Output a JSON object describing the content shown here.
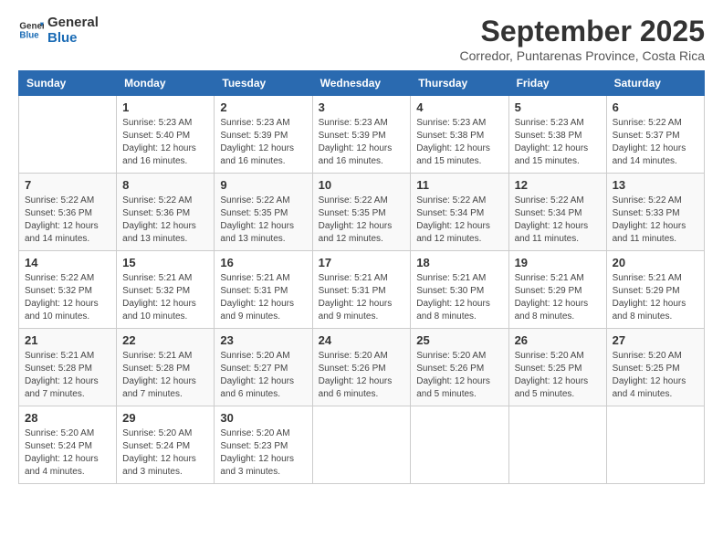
{
  "logo": {
    "text_general": "General",
    "text_blue": "Blue"
  },
  "title": {
    "month_year": "September 2025",
    "location": "Corredor, Puntarenas Province, Costa Rica"
  },
  "weekdays": [
    "Sunday",
    "Monday",
    "Tuesday",
    "Wednesday",
    "Thursday",
    "Friday",
    "Saturday"
  ],
  "weeks": [
    [
      {
        "day": "",
        "info": ""
      },
      {
        "day": "1",
        "info": "Sunrise: 5:23 AM\nSunset: 5:40 PM\nDaylight: 12 hours\nand 16 minutes."
      },
      {
        "day": "2",
        "info": "Sunrise: 5:23 AM\nSunset: 5:39 PM\nDaylight: 12 hours\nand 16 minutes."
      },
      {
        "day": "3",
        "info": "Sunrise: 5:23 AM\nSunset: 5:39 PM\nDaylight: 12 hours\nand 16 minutes."
      },
      {
        "day": "4",
        "info": "Sunrise: 5:23 AM\nSunset: 5:38 PM\nDaylight: 12 hours\nand 15 minutes."
      },
      {
        "day": "5",
        "info": "Sunrise: 5:23 AM\nSunset: 5:38 PM\nDaylight: 12 hours\nand 15 minutes."
      },
      {
        "day": "6",
        "info": "Sunrise: 5:22 AM\nSunset: 5:37 PM\nDaylight: 12 hours\nand 14 minutes."
      }
    ],
    [
      {
        "day": "7",
        "info": "Sunrise: 5:22 AM\nSunset: 5:36 PM\nDaylight: 12 hours\nand 14 minutes."
      },
      {
        "day": "8",
        "info": "Sunrise: 5:22 AM\nSunset: 5:36 PM\nDaylight: 12 hours\nand 13 minutes."
      },
      {
        "day": "9",
        "info": "Sunrise: 5:22 AM\nSunset: 5:35 PM\nDaylight: 12 hours\nand 13 minutes."
      },
      {
        "day": "10",
        "info": "Sunrise: 5:22 AM\nSunset: 5:35 PM\nDaylight: 12 hours\nand 12 minutes."
      },
      {
        "day": "11",
        "info": "Sunrise: 5:22 AM\nSunset: 5:34 PM\nDaylight: 12 hours\nand 12 minutes."
      },
      {
        "day": "12",
        "info": "Sunrise: 5:22 AM\nSunset: 5:34 PM\nDaylight: 12 hours\nand 11 minutes."
      },
      {
        "day": "13",
        "info": "Sunrise: 5:22 AM\nSunset: 5:33 PM\nDaylight: 12 hours\nand 11 minutes."
      }
    ],
    [
      {
        "day": "14",
        "info": "Sunrise: 5:22 AM\nSunset: 5:32 PM\nDaylight: 12 hours\nand 10 minutes."
      },
      {
        "day": "15",
        "info": "Sunrise: 5:21 AM\nSunset: 5:32 PM\nDaylight: 12 hours\nand 10 minutes."
      },
      {
        "day": "16",
        "info": "Sunrise: 5:21 AM\nSunset: 5:31 PM\nDaylight: 12 hours\nand 9 minutes."
      },
      {
        "day": "17",
        "info": "Sunrise: 5:21 AM\nSunset: 5:31 PM\nDaylight: 12 hours\nand 9 minutes."
      },
      {
        "day": "18",
        "info": "Sunrise: 5:21 AM\nSunset: 5:30 PM\nDaylight: 12 hours\nand 8 minutes."
      },
      {
        "day": "19",
        "info": "Sunrise: 5:21 AM\nSunset: 5:29 PM\nDaylight: 12 hours\nand 8 minutes."
      },
      {
        "day": "20",
        "info": "Sunrise: 5:21 AM\nSunset: 5:29 PM\nDaylight: 12 hours\nand 8 minutes."
      }
    ],
    [
      {
        "day": "21",
        "info": "Sunrise: 5:21 AM\nSunset: 5:28 PM\nDaylight: 12 hours\nand 7 minutes."
      },
      {
        "day": "22",
        "info": "Sunrise: 5:21 AM\nSunset: 5:28 PM\nDaylight: 12 hours\nand 7 minutes."
      },
      {
        "day": "23",
        "info": "Sunrise: 5:20 AM\nSunset: 5:27 PM\nDaylight: 12 hours\nand 6 minutes."
      },
      {
        "day": "24",
        "info": "Sunrise: 5:20 AM\nSunset: 5:26 PM\nDaylight: 12 hours\nand 6 minutes."
      },
      {
        "day": "25",
        "info": "Sunrise: 5:20 AM\nSunset: 5:26 PM\nDaylight: 12 hours\nand 5 minutes."
      },
      {
        "day": "26",
        "info": "Sunrise: 5:20 AM\nSunset: 5:25 PM\nDaylight: 12 hours\nand 5 minutes."
      },
      {
        "day": "27",
        "info": "Sunrise: 5:20 AM\nSunset: 5:25 PM\nDaylight: 12 hours\nand 4 minutes."
      }
    ],
    [
      {
        "day": "28",
        "info": "Sunrise: 5:20 AM\nSunset: 5:24 PM\nDaylight: 12 hours\nand 4 minutes."
      },
      {
        "day": "29",
        "info": "Sunrise: 5:20 AM\nSunset: 5:24 PM\nDaylight: 12 hours\nand 3 minutes."
      },
      {
        "day": "30",
        "info": "Sunrise: 5:20 AM\nSunset: 5:23 PM\nDaylight: 12 hours\nand 3 minutes."
      },
      {
        "day": "",
        "info": ""
      },
      {
        "day": "",
        "info": ""
      },
      {
        "day": "",
        "info": ""
      },
      {
        "day": "",
        "info": ""
      }
    ]
  ]
}
